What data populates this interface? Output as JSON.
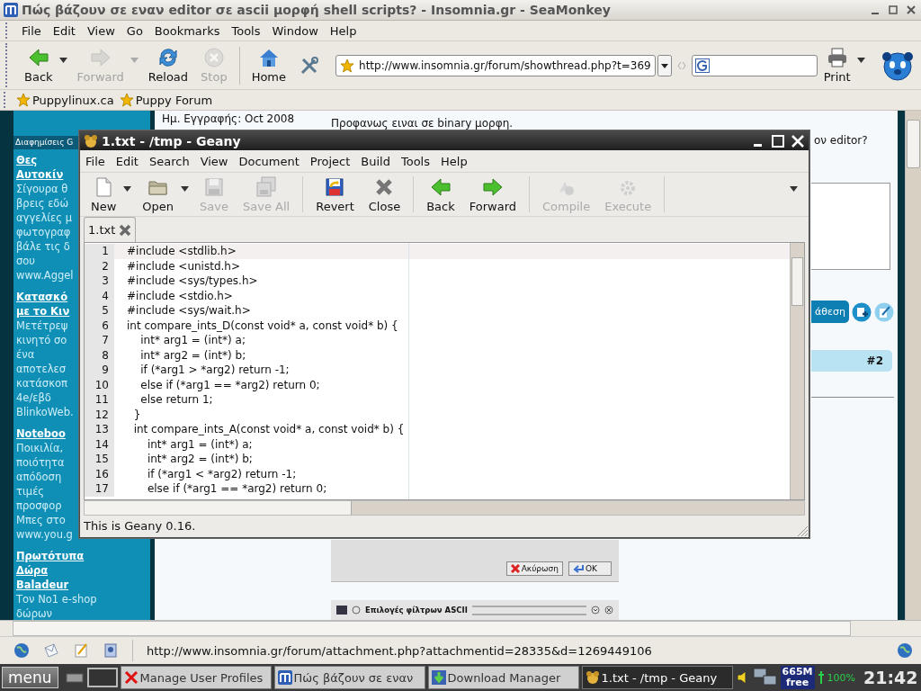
{
  "browser": {
    "title": "Πώς βάζουν σε εναν editor σε ascii μορφή shell scripts? - Insomnia.gr - SeaMonkey",
    "menu": [
      "File",
      "Edit",
      "View",
      "Go",
      "Bookmarks",
      "Tools",
      "Window",
      "Help"
    ],
    "toolbar": [
      {
        "kind": "back",
        "label": "Back",
        "disabled": false,
        "dropdown": true
      },
      {
        "kind": "forward",
        "label": "Forward",
        "disabled": true,
        "dropdown": true
      },
      {
        "kind": "reload",
        "label": "Reload",
        "disabled": false,
        "dropdown": false
      },
      {
        "kind": "stop",
        "label": "Stop",
        "disabled": true,
        "dropdown": false
      },
      {
        "kind": "home",
        "label": "Home",
        "disabled": false,
        "dropdown": false
      },
      {
        "kind": "tools",
        "disabled": false,
        "dropdown": false
      }
    ],
    "url": "http://www.insomnia.gr/forum/showthread.php?t=369",
    "print": "Print",
    "bookmarks": [
      "Puppylinux.ca",
      "Puppy Forum"
    ],
    "ads": {
      "header": "Διαφημίσεις G",
      "items": [
        {
          "title": [
            "Θες",
            "Αυτοκίν"
          ],
          "body": [
            "Σίγουρα θ",
            "βρεις εδώ",
            "αγγελίες μ",
            "φωτογραφ",
            "βάλε τις δ",
            "σου",
            "www.Aggel"
          ]
        },
        {
          "title": [
            "Κατασκό",
            "με το Κιν"
          ],
          "body": [
            "Μετέτρεψ",
            "κινητό σο",
            "ένα",
            "αποτελεσ",
            "κατάσκοπ",
            "4e/εβδ",
            "BlinkoWeb."
          ]
        },
        {
          "title": [
            "Noteboo"
          ],
          "body": [
            "Ποικιλία,",
            "ποιότητα",
            "απόδοση",
            "τιμές",
            "προσφορ",
            "Μπες στο",
            "www.you.g"
          ]
        },
        {
          "title": [
            "Πρωτότυπα",
            "Δώρα",
            "Baladeur"
          ],
          "body": [
            "Τον Νο1 e-shop",
            "δώρων"
          ]
        }
      ]
    },
    "page": {
      "member_info": "Ημ. Εγγραφής: Oct 2008",
      "post_text": "Προφανως ειναι σε binary μορφη.",
      "question_end": "ον editor?",
      "quote_button": "άθεση",
      "post_number": "#2",
      "attachment": {
        "buttons": [
          "Ακύρωση",
          "OK"
        ],
        "dialog_title": "Επιλογές φίλτρων ASCII"
      }
    },
    "status_url": "http://www.insomnia.gr/forum/attachment.php?attachmentid=28335&d=1269449106"
  },
  "editor": {
    "title": "1.txt - /tmp - Geany",
    "menu": [
      "File",
      "Edit",
      "Search",
      "View",
      "Document",
      "Project",
      "Build",
      "Tools",
      "Help"
    ],
    "toolbar": [
      {
        "kind": "new",
        "label": "New",
        "disabled": false,
        "dropdown": true
      },
      {
        "kind": "open",
        "label": "Open",
        "disabled": false,
        "dropdown": true
      },
      {
        "kind": "save",
        "label": "Save",
        "disabled": true,
        "dropdown": false
      },
      {
        "kind": "saveall",
        "label": "Save All",
        "disabled": true,
        "dropdown": false
      },
      {
        "kind": "revert",
        "label": "Revert",
        "disabled": false,
        "dropdown": false
      },
      {
        "kind": "close",
        "label": "Close",
        "disabled": false,
        "dropdown": false
      },
      {
        "kind": "back",
        "label": "Back",
        "disabled": false,
        "dropdown": false
      },
      {
        "kind": "forward",
        "label": "Forward",
        "disabled": false,
        "dropdown": false
      },
      {
        "kind": "compile",
        "label": "Compile",
        "disabled": true,
        "dropdown": false
      },
      {
        "kind": "execute",
        "label": "Execute",
        "disabled": true,
        "dropdown": false
      }
    ],
    "tabs": [
      {
        "label": "1.txt",
        "selected": true
      }
    ],
    "lines": [
      {
        "number": "1",
        "code": "#include <stdlib.h>",
        "current": true
      },
      {
        "number": "2",
        "code": "#include <unistd.h>",
        "current": false
      },
      {
        "number": "3",
        "code": "#include <sys/types.h>",
        "current": false
      },
      {
        "number": "4",
        "code": "#include <stdio.h>",
        "current": false
      },
      {
        "number": "5",
        "code": "#include <sys/wait.h>",
        "current": false
      },
      {
        "number": "6",
        "code": "int compare_ints_D(const void* a, const void* b) {",
        "current": false
      },
      {
        "number": "7",
        "code": "    int* arg1 = (int*) a;",
        "current": false
      },
      {
        "number": "8",
        "code": "    int* arg2 = (int*) b;",
        "current": false
      },
      {
        "number": "9",
        "code": "    if (*arg1 > *arg2) return -1;",
        "current": false
      },
      {
        "number": "10",
        "code": "    else if (*arg1 == *arg2) return 0;",
        "current": false
      },
      {
        "number": "11",
        "code": "    else return 1;",
        "current": false
      },
      {
        "number": "12",
        "code": "  }",
        "current": false
      },
      {
        "number": "13",
        "code": "  int compare_ints_A(const void* a, const void* b) {",
        "current": false
      },
      {
        "number": "14",
        "code": "      int* arg1 = (int*) a;",
        "current": false
      },
      {
        "number": "15",
        "code": "      int* arg2 = (int*) b;",
        "current": false
      },
      {
        "number": "16",
        "code": "      if (*arg1 < *arg2) return -1;",
        "current": false
      },
      {
        "number": "17",
        "code": "      else if (*arg1 == *arg2) return 0;",
        "current": false
      }
    ],
    "status": "This is Geany 0.16."
  },
  "taskbar": {
    "menu": "menu",
    "tasks": [
      {
        "kind": "profiles",
        "label": "Manage User Profiles",
        "selected": false
      },
      {
        "kind": "browser",
        "label": "Πώς βάζουν σε εναν",
        "selected": false
      },
      {
        "kind": "download",
        "label": "Download Manager",
        "selected": false
      },
      {
        "kind": "geany",
        "label": "1.txt - /tmp - Geany",
        "selected": true
      }
    ],
    "memory": [
      "665M",
      "free"
    ],
    "battery": "100%",
    "clock": "21:42"
  }
}
